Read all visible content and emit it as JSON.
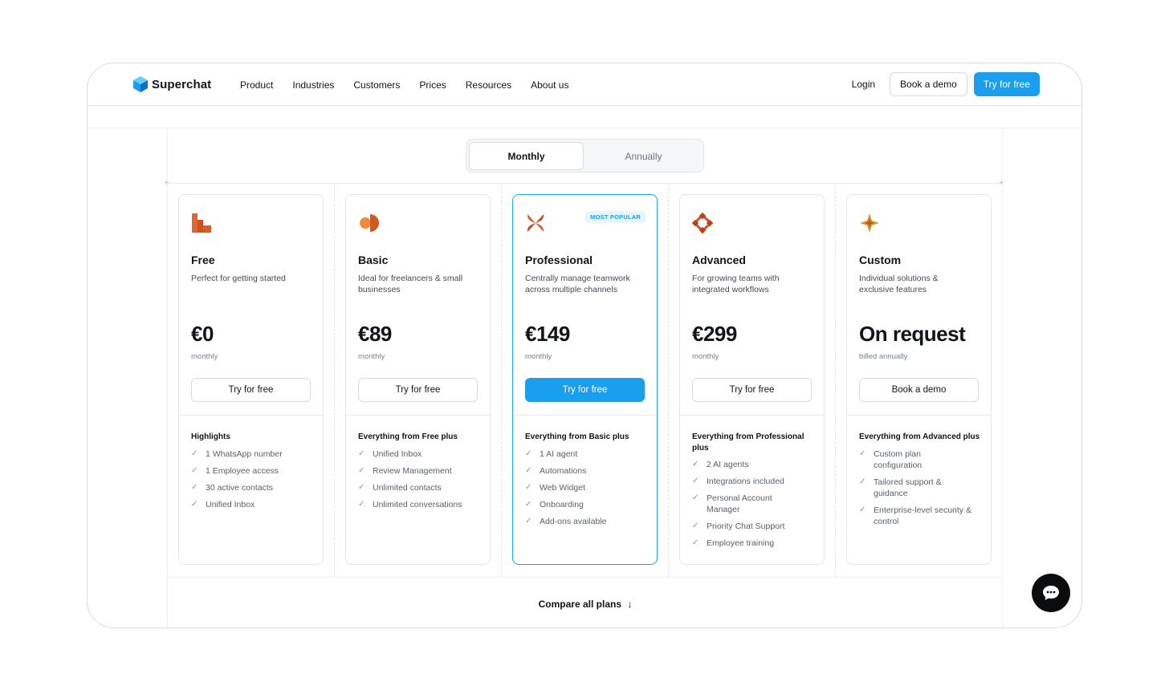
{
  "brand": {
    "name": "Superchat",
    "accent": "#1a9eee"
  },
  "nav": {
    "items": [
      "Product",
      "Industries",
      "Customers",
      "Prices",
      "Resources",
      "About us"
    ],
    "login": "Login",
    "book_demo": "Book a demo",
    "try_free": "Try for free"
  },
  "billing": {
    "monthly": "Monthly",
    "annually": "Annually",
    "selected": "Monthly"
  },
  "plans": [
    {
      "name": "Free",
      "desc": "Perfect for getting started",
      "price": "€0",
      "note": "monthly",
      "cta": "Try for free",
      "features_title": "Highlights",
      "features": [
        "1 WhatsApp number",
        "1 Employee access",
        "30 active contacts",
        "Unified Inbox"
      ]
    },
    {
      "name": "Basic",
      "desc": "Ideal for freelancers & small businesses",
      "price": "€89",
      "note": "monthly",
      "cta": "Try for free",
      "features_title": "Everything from Free plus",
      "features": [
        "Unified Inbox",
        "Review Management",
        "Unlimited contacts",
        "Unlimited conversations"
      ]
    },
    {
      "name": "Professional",
      "desc": "Centrally manage teamwork across multiple channels",
      "price": "€149",
      "note": "monthly",
      "cta": "Try for free",
      "features_title": "Everything from Basic plus",
      "badge": "MOST POPULAR",
      "features": [
        "1 AI agent",
        "Automations",
        "Web Widget",
        "Onboarding",
        "Add-ons available"
      ]
    },
    {
      "name": "Advanced",
      "desc": "For growing teams with integrated workflows",
      "price": "€299",
      "note": "monthly",
      "cta": "Try for free",
      "features_title": "Everything from Professional plus",
      "features": [
        "2 AI agents",
        "Integrations included",
        "Personal Account Manager",
        "Priority Chat Support",
        "Employee training"
      ]
    },
    {
      "name": "Custom",
      "desc": "Individual solutions & exclusive features",
      "price": "On request",
      "note": "billed annually",
      "cta": "Book a demo",
      "features_title": "Everything from Advanced plus",
      "features": [
        "Custom plan configuration",
        "Tailored support & guidance",
        "Enterprise-level security & control"
      ]
    }
  ],
  "compare": "Compare all plans",
  "icons": {
    "chat": "chat-bubble-icon",
    "arrow": "arrow-down-icon",
    "check": "check-icon"
  }
}
